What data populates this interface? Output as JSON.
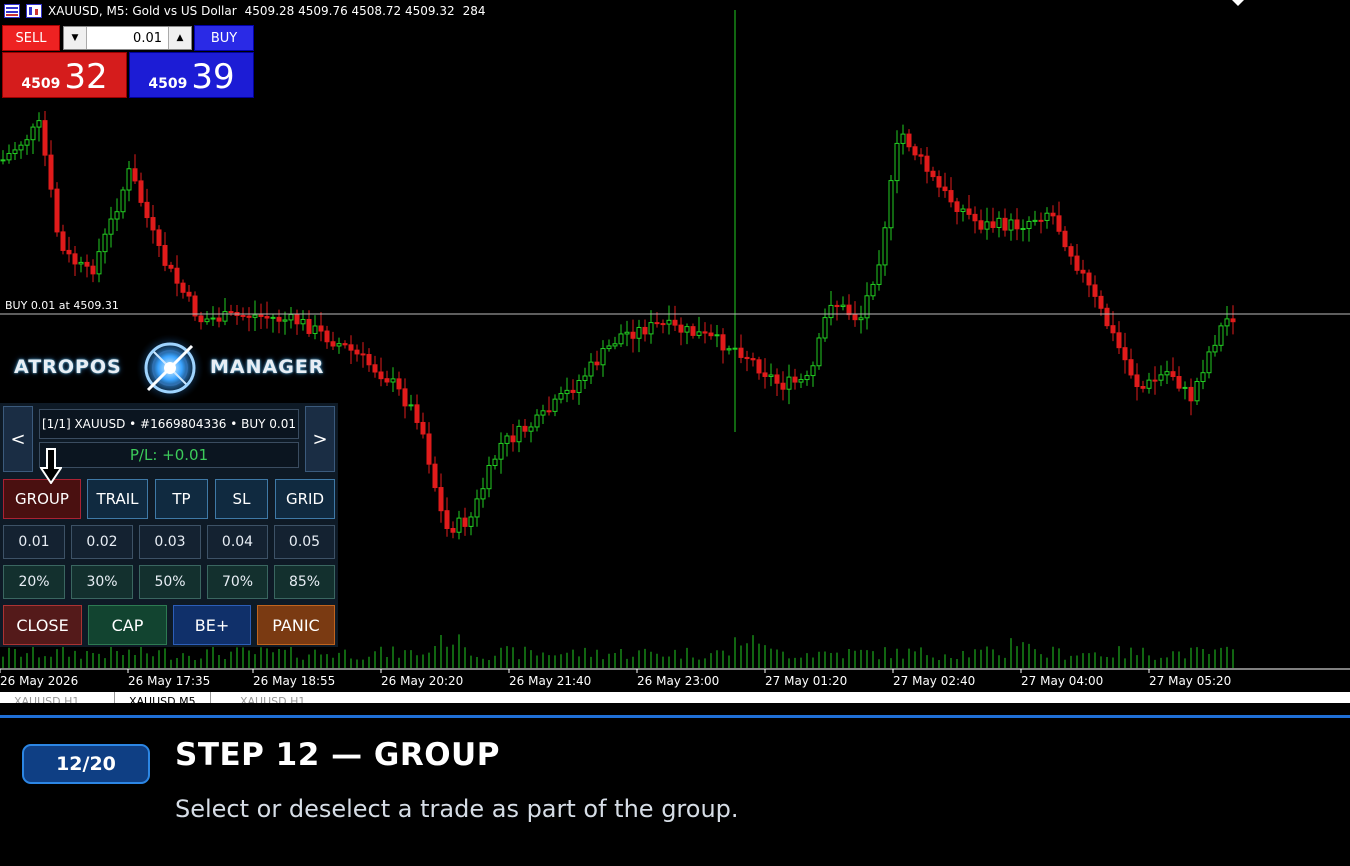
{
  "window": {
    "symbol_line": "XAUUSD, M5:  Gold vs US Dollar",
    "ohlc": "4509.28 4509.76 4508.72 4509.32",
    "spread": "284"
  },
  "trade_box": {
    "sell_label": "SELL",
    "buy_label": "BUY",
    "lot_value": "0.01",
    "sell_price_small": "4509",
    "sell_price_big": "32",
    "buy_price_small": "4509",
    "buy_price_big": "39",
    "sell_color": "#e22222",
    "buy_color": "#2a2ae6"
  },
  "order_line": {
    "label": "BUY 0.01 at 4509.31"
  },
  "logo": {
    "word_left": "ATROPOS",
    "word_right": "MANAGER"
  },
  "panel": {
    "prev_label": "<",
    "next_label": ">",
    "trade_info": "[1/1] XAUUSD • #1669804336 • BUY 0.01",
    "pl_text": "P/L: +0.01",
    "modes": [
      "GROUP",
      "TRAIL",
      "TP",
      "SL",
      "GRID"
    ],
    "active_mode": "GROUP",
    "lots": [
      "0.01",
      "0.02",
      "0.03",
      "0.04",
      "0.05"
    ],
    "percents": [
      "20%",
      "30%",
      "50%",
      "70%",
      "85%"
    ],
    "actions": [
      {
        "label": "CLOSE",
        "bg": "#541a1a",
        "border": "#a33"
      },
      {
        "label": "CAP",
        "bg": "#124430",
        "border": "#2d7a52"
      },
      {
        "label": "BE+",
        "bg": "#10306a",
        "border": "#2c5eb8"
      },
      {
        "label": "PANIC",
        "bg": "#7a3a12",
        "border": "#c0641e"
      }
    ]
  },
  "time_axis": [
    "26 May 2026",
    "26 May 17:35",
    "26 May 18:55",
    "26 May 20:20",
    "26 May 21:40",
    "26 May 23:00",
    "27 May 01:20",
    "27 May 02:40",
    "27 May 04:00",
    "27 May 05:20"
  ],
  "tabs": [
    "XAUUSD,H1",
    "XAUUSD,M5",
    "XAUUSD,H1"
  ],
  "active_tab": "XAUUSD,M5",
  "tutorial": {
    "badge": "12/20",
    "title": "STEP 12 — GROUP",
    "description": "Select or deselect a trade as part of the group.",
    "accent_color": "#1f6fd6"
  },
  "colors": {
    "bull": "#22cc22",
    "bear": "#e01b1b",
    "volume": "#22cc22"
  }
}
